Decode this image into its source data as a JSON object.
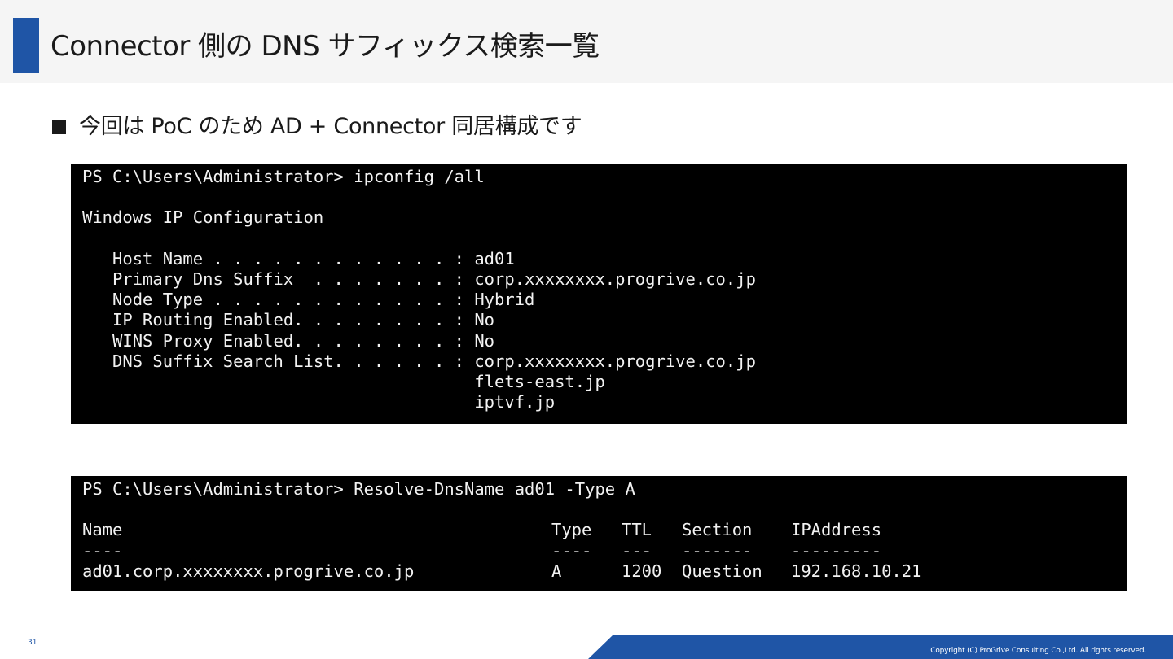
{
  "slide": {
    "title": "Connector 側の DNS サフィックス検索一覧",
    "bullet": "今回は PoC のため AD + Connector 同居構成です",
    "page_number": "31",
    "copyright": "Copyright (C) ProGrive Consulting Co.,Ltd. All rights reserved.",
    "colors": {
      "accent": "#1f55a6",
      "header_bg": "#f5f5f5",
      "terminal_bg": "#000000",
      "terminal_fg": "#f2f2f2"
    }
  },
  "terminal1": {
    "lines": [
      "PS C:\\Users\\Administrator> ipconfig /all",
      "",
      "Windows IP Configuration",
      "",
      "   Host Name . . . . . . . . . . . . : ad01",
      "   Primary Dns Suffix  . . . . . . . : corp.xxxxxxxx.progrive.co.jp",
      "   Node Type . . . . . . . . . . . . : Hybrid",
      "   IP Routing Enabled. . . . . . . . : No",
      "   WINS Proxy Enabled. . . . . . . . : No",
      "   DNS Suffix Search List. . . . . . : corp.xxxxxxxx.progrive.co.jp",
      "                                       flets-east.jp",
      "                                       iptvf.jp"
    ]
  },
  "terminal2": {
    "command": "PS C:\\Users\\Administrator> Resolve-DnsName ad01 -Type A",
    "headers": [
      "Name",
      "Type",
      "TTL",
      "Section",
      "IPAddress"
    ],
    "separators": [
      "----",
      "----",
      "---",
      "-------",
      "---------"
    ],
    "rows": [
      [
        "ad01.corp.xxxxxxxx.progrive.co.jp",
        "A",
        "1200",
        "Question",
        "192.168.10.21"
      ]
    ]
  }
}
